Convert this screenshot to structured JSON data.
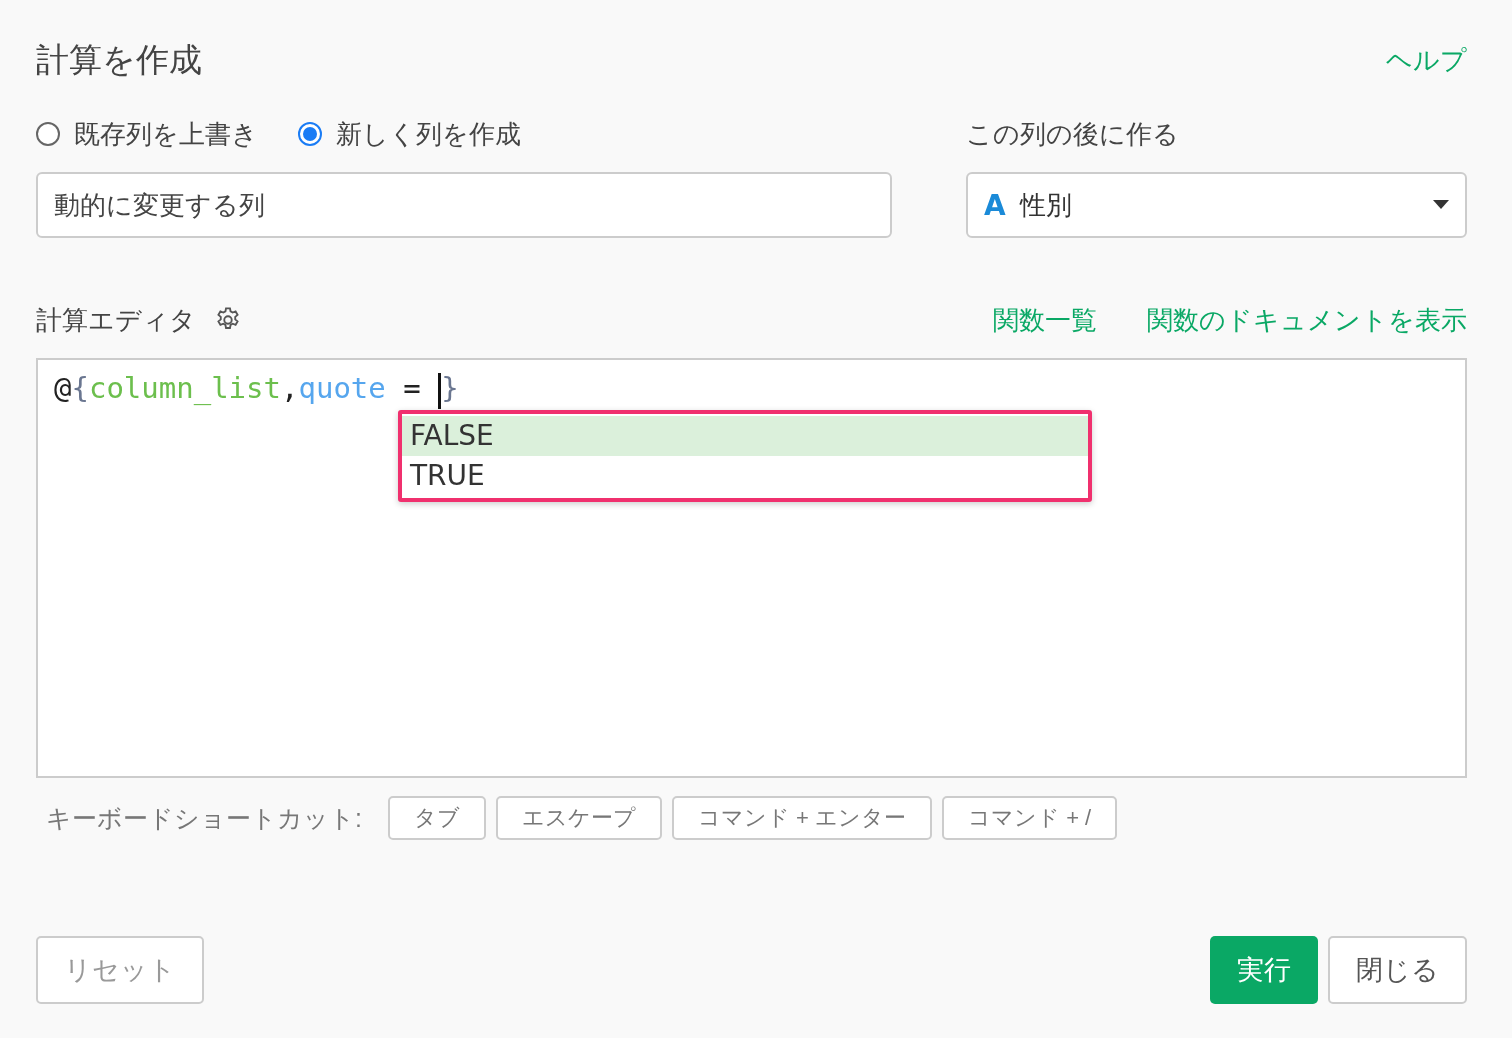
{
  "dialog": {
    "title": "計算を作成",
    "help_link": "ヘルプ"
  },
  "mode_options": [
    {
      "label": "既存列を上書き",
      "selected": false
    },
    {
      "label": "新しく列を作成",
      "selected": true
    }
  ],
  "column_name": {
    "value": "動的に変更する列"
  },
  "insert_after": {
    "label": "この列の後に作る",
    "type_icon": "A",
    "value": "性別"
  },
  "editor": {
    "title": "計算エディタ",
    "links": [
      "関数一覧",
      "関数のドキュメントを表示"
    ],
    "code": [
      {
        "kind": "punct",
        "text": "@"
      },
      {
        "kind": "brace",
        "text": "{"
      },
      {
        "kind": "name",
        "text": "column_list"
      },
      {
        "kind": "punct",
        "text": ","
      },
      {
        "kind": "key",
        "text": "quote"
      },
      {
        "kind": "punct",
        "text": " = "
      },
      {
        "kind": "cursor"
      },
      {
        "kind": "brace",
        "text": "}"
      }
    ],
    "suggestions": [
      {
        "label": "FALSE",
        "selected": true
      },
      {
        "label": "TRUE",
        "selected": false
      }
    ]
  },
  "shortcuts": {
    "label": "キーボードショートカット:",
    "keys": [
      "タブ",
      "エスケープ",
      "コマンド + エンター",
      "コマンド + /"
    ]
  },
  "buttons": [
    {
      "label": "リセット",
      "kind": "secondary"
    },
    {
      "label": "実行",
      "kind": "primary"
    },
    {
      "label": "閉じる",
      "kind": "secondary"
    }
  ]
}
